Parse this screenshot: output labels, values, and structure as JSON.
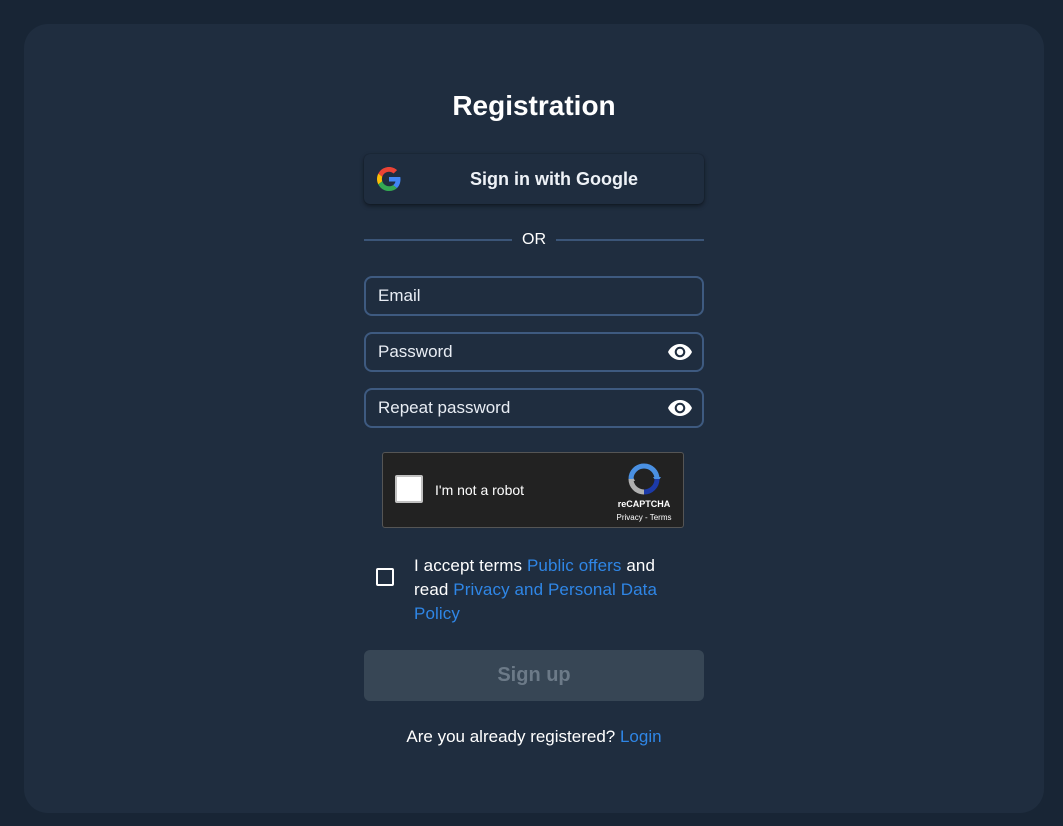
{
  "title": "Registration",
  "google": {
    "label": "Sign in with Google",
    "icon": "google-icon"
  },
  "divider": {
    "label": "OR"
  },
  "fields": {
    "email": {
      "placeholder": "Email",
      "value": ""
    },
    "password": {
      "placeholder": "Password",
      "value": "",
      "icon": "eye-icon"
    },
    "repeat_password": {
      "placeholder": "Repeat password",
      "value": "",
      "icon": "eye-icon"
    }
  },
  "captcha": {
    "label": "I'm not a robot",
    "brand": "reCAPTCHA",
    "privacy": "Privacy",
    "separator": " - ",
    "terms": "Terms",
    "icon": "recaptcha-icon"
  },
  "terms": {
    "text1": "I accept terms ",
    "link1": "Public offers",
    "text2": " and read ",
    "link2": "Privacy and Personal Data Policy",
    "checked": false
  },
  "signup": {
    "label": "Sign up",
    "enabled": false
  },
  "login": {
    "prompt": "Are you already registered? ",
    "link": "Login"
  },
  "colors": {
    "page_bg": "#182535",
    "card_bg": "#1f2d3f",
    "field_border": "#3e5a80",
    "link": "#2f86e6",
    "signup_bg": "#374655",
    "signup_text": "#6c7a88"
  }
}
